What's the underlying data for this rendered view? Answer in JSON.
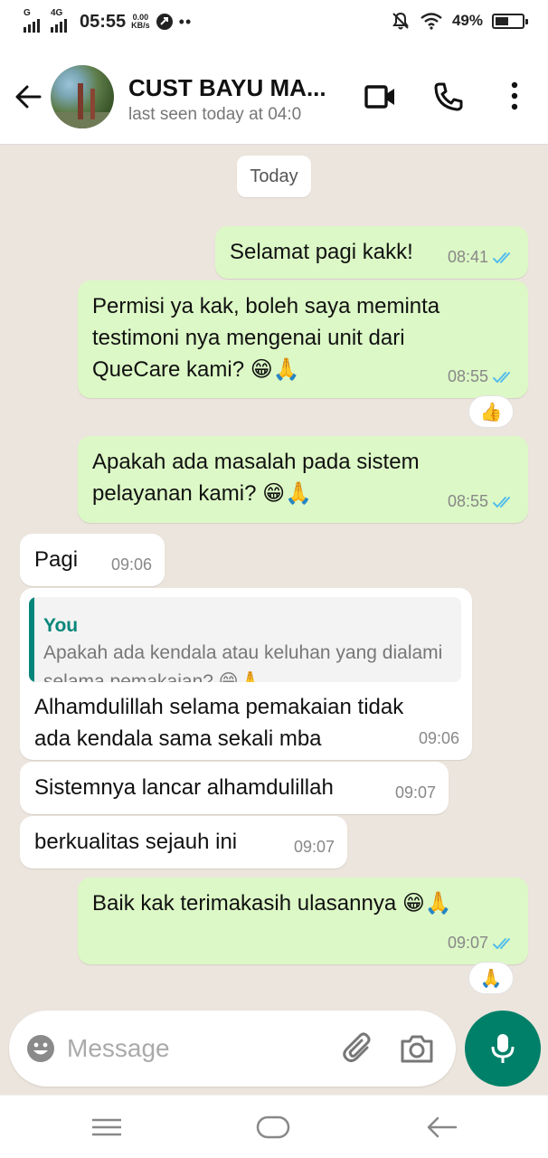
{
  "status_bar": {
    "network_1": "G",
    "network_2": "4G",
    "time": "05:55",
    "speed_value": "0.00",
    "speed_unit": "KB/s",
    "battery": "49%",
    "battery_level": 0.49,
    "icons": [
      "signal-icon",
      "signal-icon",
      "sync-icon",
      "mute-icon",
      "wifi-icon",
      "battery-icon"
    ]
  },
  "header": {
    "contact_name": "CUST BAYU MA...",
    "last_seen": "last seen today at 04:0",
    "icons": [
      "back-arrow-icon",
      "video-call-icon",
      "phone-icon",
      "more-vertical-icon"
    ]
  },
  "chat": {
    "date_label": "Today",
    "messages": [
      {
        "dir": "out",
        "lines": [
          "Selamat pagi kakk!"
        ],
        "time": "08:41",
        "read": true
      },
      {
        "dir": "out",
        "lines": [
          "Permisi ya kak, boleh saya meminta",
          "testimoni nya mengenai unit dari",
          "QueCare kami? 😁🙏"
        ],
        "time": "08:55",
        "read": true,
        "reaction": "👍"
      },
      {
        "dir": "out",
        "lines": [
          "Apakah ada masalah pada sistem",
          "pelayanan kami? 😁🙏"
        ],
        "time": "08:55",
        "read": true
      },
      {
        "dir": "in",
        "lines": [
          "Pagi"
        ],
        "time": "09:06"
      },
      {
        "dir": "in",
        "quote": {
          "author": "You",
          "text": "Apakah ada kendala atau keluhan yang dialami selama pemakaian? 😁🙏"
        },
        "lines": [
          "Alhamdulillah selama pemakaian tidak",
          "ada kendala sama sekali mba"
        ],
        "time": "09:06"
      },
      {
        "dir": "in",
        "lines": [
          "Sistemnya lancar alhamdulillah"
        ],
        "time": "09:07"
      },
      {
        "dir": "in",
        "lines": [
          "berkualitas sejauh ini"
        ],
        "time": "09:07"
      },
      {
        "dir": "out",
        "lines": [
          "Baik kak terimakasih ulasannya 😁🙏"
        ],
        "time": "09:07",
        "read": true,
        "reaction": "🙏"
      }
    ]
  },
  "input": {
    "placeholder": "Message",
    "value": "",
    "icons": [
      "emoji-icon",
      "attach-icon",
      "camera-icon",
      "mic-icon"
    ]
  },
  "nav_bar": {
    "icons": [
      "menu-icon",
      "home-icon",
      "back-icon"
    ]
  },
  "colors": {
    "header_bg": "#ffffff",
    "chat_bg": "#ece5dd",
    "outgoing_bubble": "#dcf8c6",
    "incoming_bubble": "#ffffff",
    "read_tick": "#53bdeb",
    "accent": "#008069",
    "quote_accent": "#06867a"
  }
}
